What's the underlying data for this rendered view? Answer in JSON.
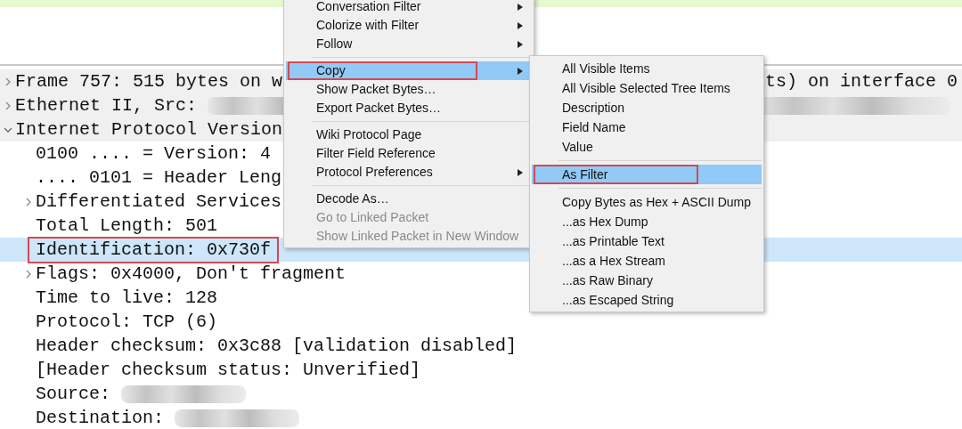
{
  "tree": [
    {
      "segments": [
        {
          "kind": "text",
          "text": "Frame 757: 515 bytes on w"
        }
      ],
      "right_segments": [
        {
          "kind": "text",
          "text": "ts) on interface 0"
        }
      ],
      "expanded": false,
      "selected": false,
      "annotated": false
    },
    {
      "segments": [
        {
          "kind": "text",
          "text": "Ethernet II, Src:"
        },
        {
          "kind": "blur"
        }
      ],
      "right_segments": [
        {
          "kind": "blur"
        }
      ],
      "expanded": false,
      "selected": false,
      "annotated": false
    },
    {
      "segments": [
        {
          "kind": "text",
          "text": "Internet Protocol Version"
        }
      ],
      "expanded": true,
      "selected": false,
      "annotated": false,
      "children": [
        {
          "segments": [
            {
              "kind": "text",
              "text": "0100 .... = Version: 4"
            }
          ],
          "selected": false,
          "annotated": false
        },
        {
          "segments": [
            {
              "kind": "text",
              "text": ".... 0101 = Header Leng"
            }
          ],
          "selected": false,
          "annotated": false
        },
        {
          "segments": [
            {
              "kind": "text",
              "text": "Differentiated Services"
            }
          ],
          "expanded": false,
          "selected": false,
          "annotated": false
        },
        {
          "segments": [
            {
              "kind": "text",
              "text": "Total Length: 501"
            }
          ],
          "selected": false,
          "annotated": false
        },
        {
          "segments": [
            {
              "kind": "text",
              "text": "Identification: 0x730f"
            }
          ],
          "selected": true,
          "annotated": true
        },
        {
          "segments": [
            {
              "kind": "text",
              "text": "Flags: 0x4000, Don't fragment"
            }
          ],
          "expanded": false,
          "selected": false,
          "annotated": false
        },
        {
          "segments": [
            {
              "kind": "text",
              "text": "Time to live: 128"
            }
          ],
          "selected": false,
          "annotated": false
        },
        {
          "segments": [
            {
              "kind": "text",
              "text": "Protocol: TCP (6)"
            }
          ],
          "selected": false,
          "annotated": false
        },
        {
          "segments": [
            {
              "kind": "text",
              "text": "Header checksum: 0x3c88 [validation disabled]"
            }
          ],
          "selected": false,
          "annotated": false
        },
        {
          "segments": [
            {
              "kind": "text",
              "text": "[Header checksum status: Unverified]"
            }
          ],
          "selected": false,
          "annotated": false
        },
        {
          "segments": [
            {
              "kind": "text",
              "text": "Source:"
            },
            {
              "kind": "blur"
            }
          ],
          "selected": false,
          "annotated": false
        },
        {
          "segments": [
            {
              "kind": "text",
              "text": "Destination:"
            },
            {
              "kind": "blur"
            }
          ],
          "selected": false,
          "annotated": false
        }
      ]
    }
  ],
  "context_menu": {
    "items": [
      {
        "kind": "item",
        "label": "Conversation Filter",
        "submenu": true,
        "selected": false,
        "disabled": false,
        "annotated": false
      },
      {
        "kind": "item",
        "label": "Colorize with Filter",
        "submenu": true,
        "selected": false,
        "disabled": false,
        "annotated": false
      },
      {
        "kind": "item",
        "label": "Follow",
        "submenu": true,
        "selected": false,
        "disabled": false,
        "annotated": false
      },
      {
        "kind": "separator"
      },
      {
        "kind": "item",
        "label": "Copy",
        "submenu": true,
        "selected": true,
        "disabled": false,
        "annotated": true
      },
      {
        "kind": "item",
        "label": "Show Packet Bytes…",
        "submenu": false,
        "selected": false,
        "disabled": false,
        "annotated": false
      },
      {
        "kind": "item",
        "label": "Export Packet Bytes…",
        "submenu": false,
        "selected": false,
        "disabled": false,
        "annotated": false
      },
      {
        "kind": "separator"
      },
      {
        "kind": "item",
        "label": "Wiki Protocol Page",
        "submenu": false,
        "selected": false,
        "disabled": false,
        "annotated": false
      },
      {
        "kind": "item",
        "label": "Filter Field Reference",
        "submenu": false,
        "selected": false,
        "disabled": false,
        "annotated": false
      },
      {
        "kind": "item",
        "label": "Protocol Preferences",
        "submenu": true,
        "selected": false,
        "disabled": false,
        "annotated": false
      },
      {
        "kind": "separator"
      },
      {
        "kind": "item",
        "label": "Decode As…",
        "submenu": false,
        "selected": false,
        "disabled": false,
        "annotated": false
      },
      {
        "kind": "item",
        "label": "Go to Linked Packet",
        "submenu": false,
        "selected": false,
        "disabled": true,
        "annotated": false
      },
      {
        "kind": "item",
        "label": "Show Linked Packet in New Window",
        "submenu": false,
        "selected": false,
        "disabled": true,
        "annotated": false
      }
    ]
  },
  "copy_submenu": {
    "items": [
      {
        "kind": "item",
        "label": "All Visible Items",
        "selected": false,
        "annotated": false
      },
      {
        "kind": "item",
        "label": "All Visible Selected Tree Items",
        "selected": false,
        "annotated": false
      },
      {
        "kind": "item",
        "label": "Description",
        "selected": false,
        "annotated": false
      },
      {
        "kind": "item",
        "label": "Field Name",
        "selected": false,
        "annotated": false
      },
      {
        "kind": "item",
        "label": "Value",
        "selected": false,
        "annotated": false
      },
      {
        "kind": "separator"
      },
      {
        "kind": "item",
        "label": "As Filter",
        "selected": true,
        "annotated": true
      },
      {
        "kind": "separator"
      },
      {
        "kind": "item",
        "label": "Copy Bytes as Hex + ASCII Dump",
        "selected": false,
        "annotated": false
      },
      {
        "kind": "item",
        "label": "...as Hex Dump",
        "selected": false,
        "annotated": false
      },
      {
        "kind": "item",
        "label": "...as Printable Text",
        "selected": false,
        "annotated": false
      },
      {
        "kind": "item",
        "label": "...as a Hex Stream",
        "selected": false,
        "annotated": false
      },
      {
        "kind": "item",
        "label": "...as Raw Binary",
        "selected": false,
        "annotated": false
      },
      {
        "kind": "item",
        "label": "...as Escaped String",
        "selected": false,
        "annotated": false
      }
    ]
  }
}
